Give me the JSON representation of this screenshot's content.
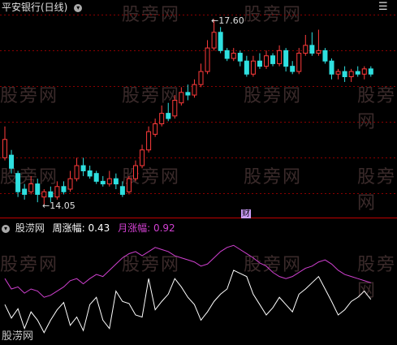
{
  "main": {
    "title": "平安银行(日线)",
    "high_label": "17.60",
    "low_label": "14.05",
    "cai_badge": "财",
    "watermark": "股旁网",
    "candles": [
      [
        14.95,
        15.3,
        15.55,
        14.9
      ],
      [
        15.0,
        14.75,
        15.1,
        14.65
      ],
      [
        14.65,
        14.3,
        14.7,
        14.2
      ],
      [
        14.35,
        14.25,
        14.45,
        14.15
      ],
      [
        14.3,
        14.45,
        14.6,
        14.25
      ],
      [
        14.45,
        14.25,
        14.55,
        14.1
      ],
      [
        14.2,
        14.3,
        14.35,
        14.05
      ],
      [
        14.3,
        14.2,
        14.4,
        14.1
      ],
      [
        14.2,
        14.4,
        14.5,
        14.15
      ],
      [
        14.4,
        14.3,
        14.5,
        14.25
      ],
      [
        14.35,
        14.55,
        14.7,
        14.3
      ],
      [
        14.55,
        14.8,
        14.95,
        14.5
      ],
      [
        14.8,
        14.7,
        14.95,
        14.6
      ],
      [
        14.7,
        14.6,
        14.8,
        14.55
      ],
      [
        14.65,
        14.5,
        14.7,
        14.45
      ],
      [
        14.5,
        14.45,
        14.6,
        14.4
      ],
      [
        14.45,
        14.55,
        14.7,
        14.4
      ],
      [
        14.55,
        14.45,
        14.65,
        14.35
      ],
      [
        14.4,
        14.25,
        14.5,
        14.2
      ],
      [
        14.3,
        14.55,
        14.6,
        14.25
      ],
      [
        14.55,
        14.8,
        14.9,
        14.5
      ],
      [
        14.8,
        15.1,
        15.2,
        14.75
      ],
      [
        15.1,
        15.45,
        15.55,
        15.05
      ],
      [
        15.4,
        15.6,
        15.7,
        15.35
      ],
      [
        15.6,
        15.8,
        15.95,
        15.55
      ],
      [
        15.8,
        15.7,
        16.0,
        15.65
      ],
      [
        15.75,
        16.05,
        16.15,
        15.7
      ],
      [
        16.0,
        16.2,
        16.3,
        15.95
      ],
      [
        16.2,
        16.15,
        16.35,
        16.05
      ],
      [
        16.15,
        16.35,
        16.45,
        16.1
      ],
      [
        16.35,
        16.6,
        16.75,
        16.3
      ],
      [
        16.6,
        17.05,
        17.2,
        16.55
      ],
      [
        17.05,
        17.35,
        17.6,
        17.0
      ],
      [
        17.35,
        17.0,
        17.45,
        16.95
      ],
      [
        17.0,
        16.85,
        17.05,
        16.8
      ],
      [
        16.85,
        16.95,
        17.05,
        16.8
      ],
      [
        16.95,
        16.8,
        17.0,
        16.7
      ],
      [
        16.8,
        16.55,
        16.9,
        16.5
      ],
      [
        16.55,
        16.8,
        16.9,
        16.5
      ],
      [
        16.8,
        16.7,
        16.95,
        16.65
      ],
      [
        16.7,
        16.9,
        17.0,
        16.65
      ],
      [
        16.9,
        16.75,
        16.95,
        16.7
      ],
      [
        16.75,
        17.0,
        17.1,
        16.7
      ],
      [
        17.0,
        16.7,
        17.05,
        16.6
      ],
      [
        16.7,
        16.6,
        16.8,
        16.55
      ],
      [
        16.6,
        16.95,
        17.05,
        16.55
      ],
      [
        16.95,
        17.1,
        17.3,
        16.9
      ],
      [
        17.1,
        16.95,
        17.35,
        16.9
      ],
      [
        16.95,
        17.0,
        17.4,
        16.9
      ],
      [
        17.0,
        16.8,
        17.05,
        16.75
      ],
      [
        16.8,
        16.55,
        16.85,
        16.45
      ],
      [
        16.55,
        16.6,
        16.65,
        16.45
      ],
      [
        16.6,
        16.5,
        16.7,
        16.4
      ],
      [
        16.5,
        16.6,
        16.65,
        16.4
      ],
      [
        16.6,
        16.55,
        16.7,
        16.5
      ],
      [
        16.55,
        16.65,
        16.7,
        16.45
      ],
      [
        16.65,
        16.55,
        16.7,
        16.5
      ]
    ]
  },
  "indicator": {
    "name": "股涝网",
    "weekly_label": "周涨幅:",
    "weekly_value": "0.43",
    "monthly_label": "月涨幅:",
    "monthly_value": "0.92",
    "footer": "股涝网",
    "colors": {
      "weekly": "#ffffff",
      "monthly": "#d040d0"
    },
    "weekly_series": [
      0.45,
      0.32,
      0.41,
      0.22,
      0.38,
      0.3,
      0.18,
      0.3,
      0.4,
      0.47,
      0.25,
      0.33,
      0.2,
      0.45,
      0.52,
      0.3,
      0.22,
      0.58,
      0.48,
      0.46,
      0.35,
      0.33,
      0.7,
      0.4,
      0.48,
      0.55,
      0.7,
      0.62,
      0.52,
      0.45,
      0.3,
      0.38,
      0.48,
      0.55,
      0.6,
      0.78,
      0.75,
      0.72,
      0.55,
      0.45,
      0.35,
      0.42,
      0.52,
      0.45,
      0.38,
      0.55,
      0.6,
      0.66,
      0.72,
      0.6,
      0.48,
      0.35,
      0.4,
      0.48,
      0.52,
      0.58,
      0.5
    ],
    "monthly_series": [
      0.7,
      0.6,
      0.62,
      0.56,
      0.6,
      0.58,
      0.52,
      0.54,
      0.58,
      0.62,
      0.68,
      0.7,
      0.65,
      0.7,
      0.74,
      0.72,
      0.78,
      0.84,
      0.9,
      0.94,
      0.96,
      0.92,
      0.96,
      1.0,
      0.98,
      0.96,
      0.92,
      0.9,
      0.88,
      0.86,
      0.82,
      0.84,
      0.9,
      0.96,
      1.0,
      1.02,
      0.98,
      0.94,
      0.9,
      0.85,
      0.82,
      0.76,
      0.72,
      0.7,
      0.72,
      0.76,
      0.8,
      0.82,
      0.86,
      0.88,
      0.84,
      0.78,
      0.74,
      0.72,
      0.7,
      0.68,
      0.66
    ]
  }
}
